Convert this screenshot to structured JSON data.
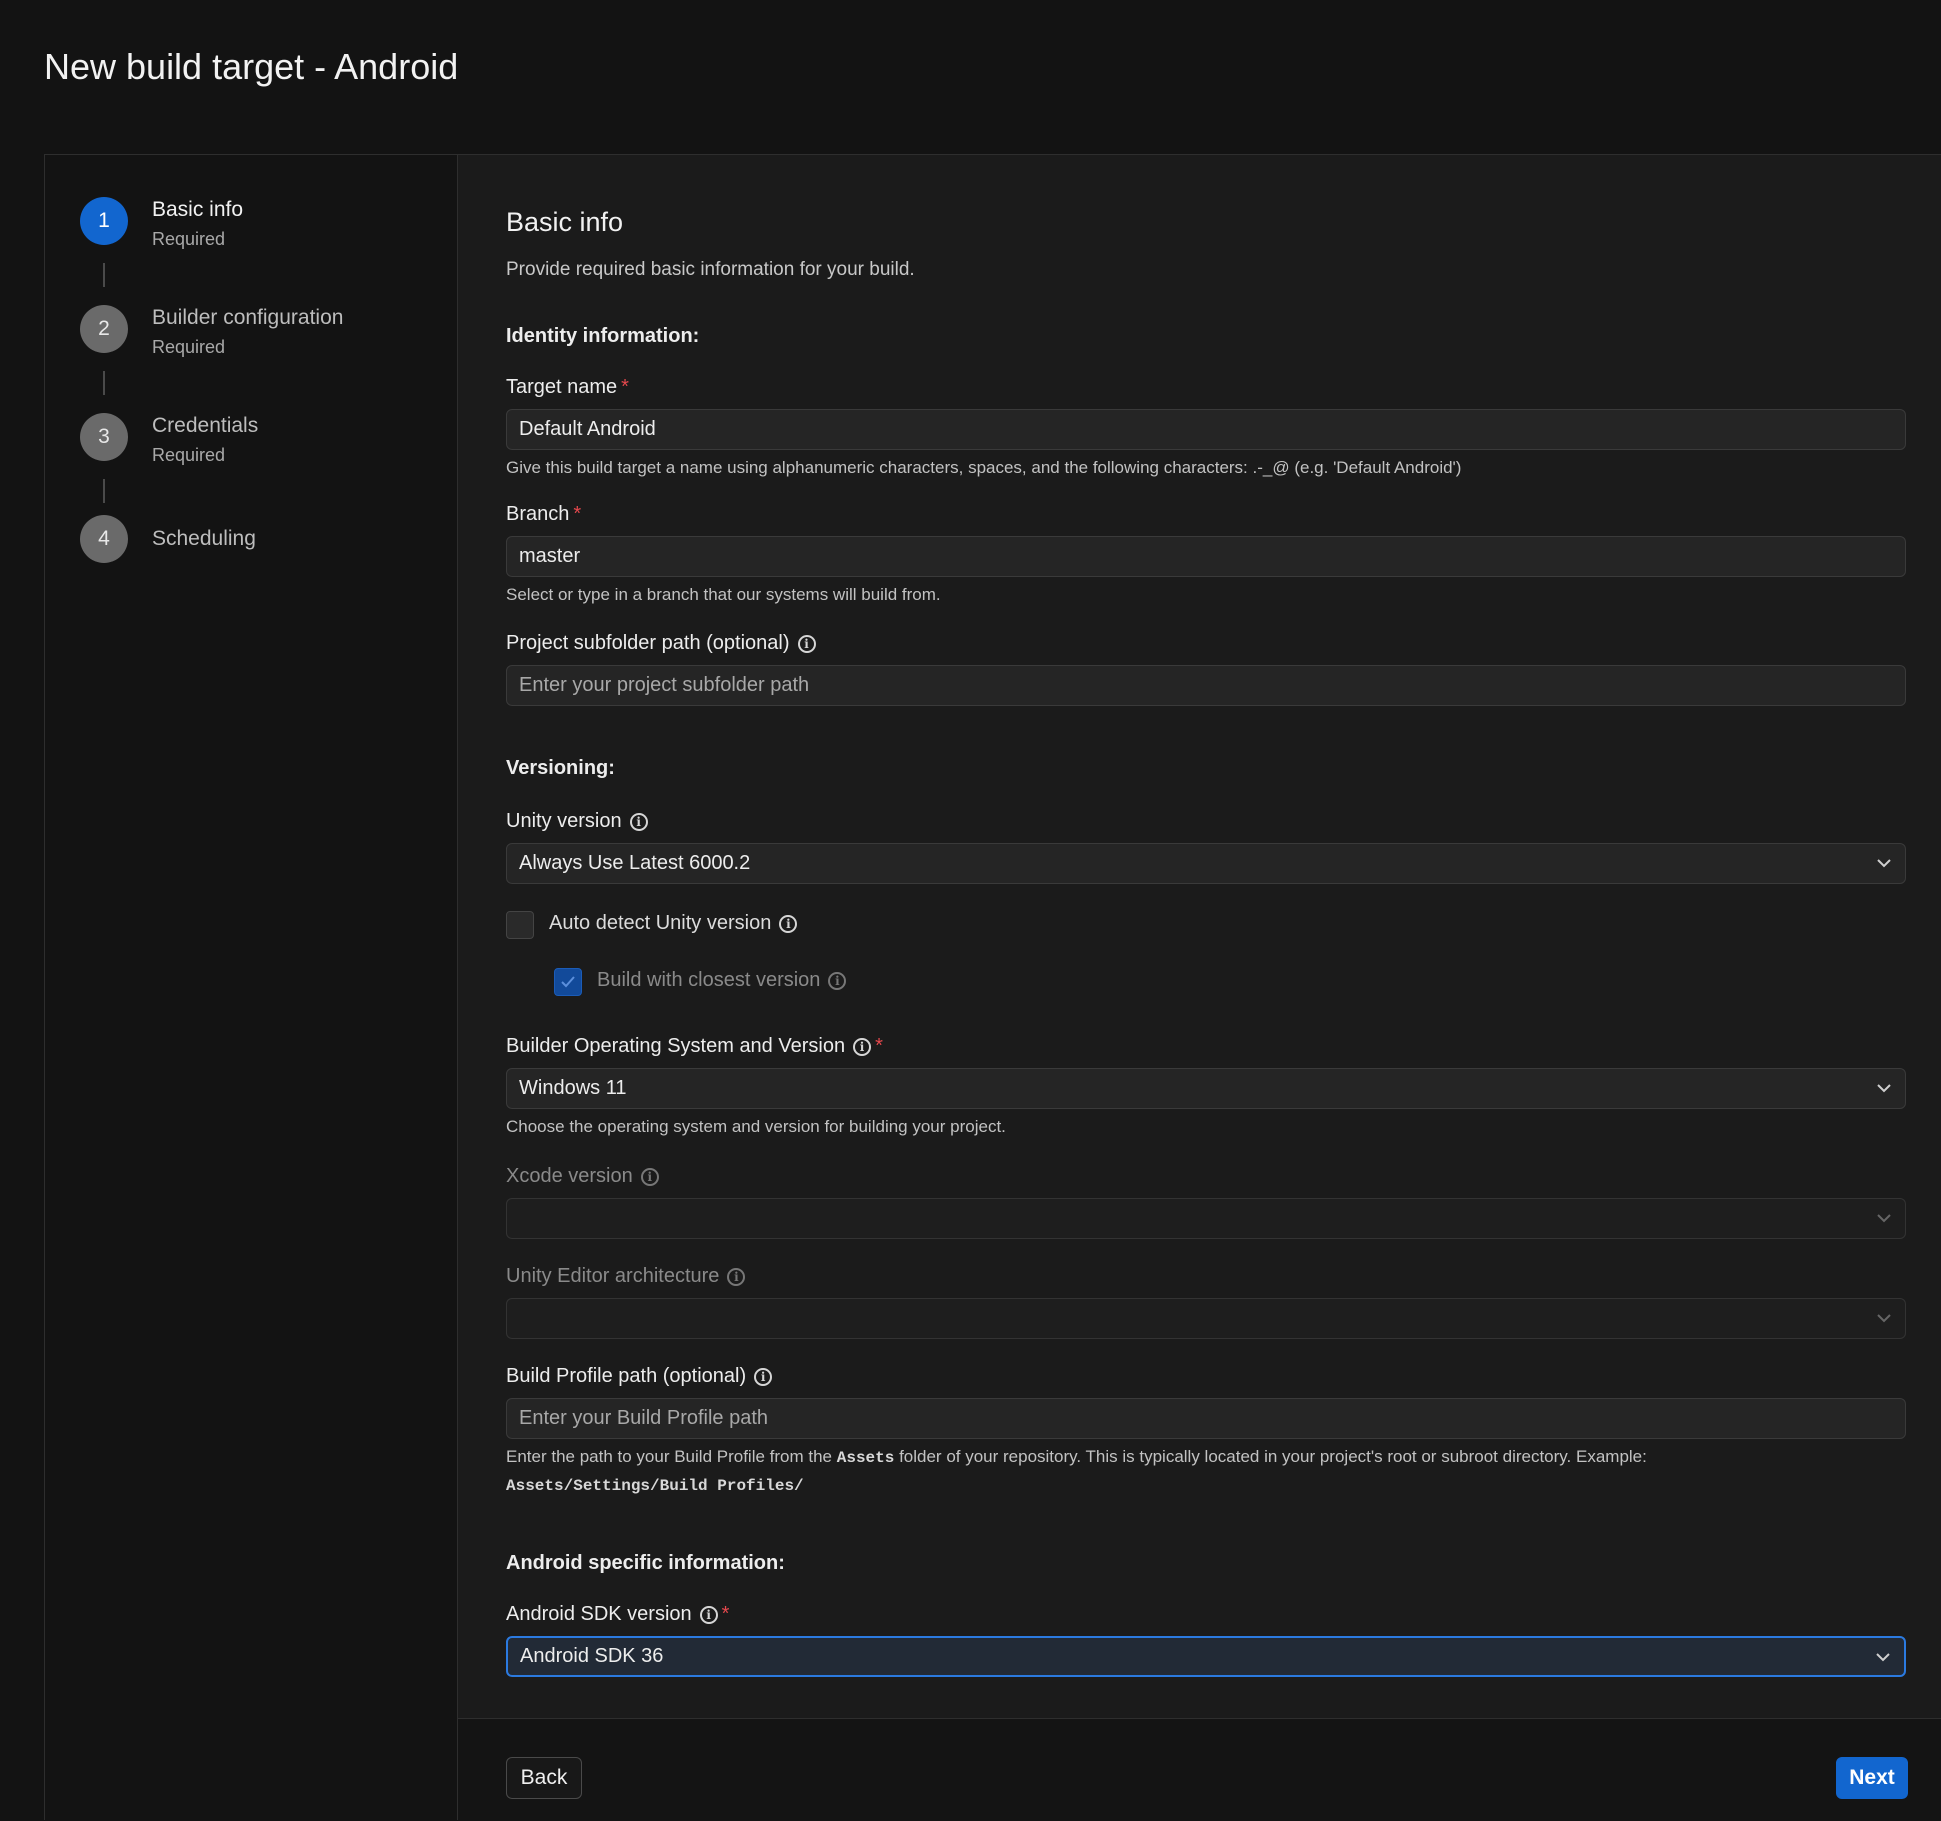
{
  "page": {
    "title": "New build target - Android"
  },
  "steps": [
    {
      "number": "1",
      "title": "Basic info",
      "subtitle": "Required",
      "active": true
    },
    {
      "number": "2",
      "title": "Builder configuration",
      "subtitle": "Required",
      "active": false
    },
    {
      "number": "3",
      "title": "Credentials",
      "subtitle": "Required",
      "active": false
    },
    {
      "number": "4",
      "title": "Scheduling",
      "subtitle": "",
      "active": false
    }
  ],
  "form": {
    "title": "Basic info",
    "description": "Provide required basic information for your build.",
    "identity": {
      "heading": "Identity information:",
      "target_name": {
        "label": "Target name",
        "required": "*",
        "value": "Default Android",
        "help": "Give this build target a name using alphanumeric characters, spaces, and the following characters: .-_@ (e.g. 'Default Android')"
      },
      "branch": {
        "label": "Branch",
        "required": "*",
        "value": "master",
        "help": "Select or type in a branch that our systems will build from."
      },
      "subfolder": {
        "label": "Project subfolder path (optional)",
        "placeholder": "Enter your project subfolder path"
      }
    },
    "versioning": {
      "heading": "Versioning:",
      "unity_version": {
        "label": "Unity version",
        "value": "Always Use Latest 6000.2"
      },
      "auto_detect": {
        "label": "Auto detect Unity version",
        "checked": false
      },
      "closest_version": {
        "label": "Build with closest version",
        "checked": true,
        "disabled": true
      },
      "builder_os": {
        "label": "Builder Operating System and Version",
        "required": "*",
        "value": "Windows 11",
        "help": "Choose the operating system and version for building your project."
      },
      "xcode": {
        "label": "Xcode version",
        "value": "",
        "disabled": true
      },
      "editor_arch": {
        "label": "Unity Editor architecture",
        "value": "",
        "disabled": true
      },
      "build_profile": {
        "label": "Build Profile path (optional)",
        "placeholder": "Enter your Build Profile path",
        "help_part1": "Enter the path to your Build Profile from the ",
        "help_code1": "Assets",
        "help_part2": " folder of your repository. This is typically located in your project's root or subroot directory. Example:",
        "help_code2": "Assets/Settings/Build Profiles/"
      }
    },
    "android": {
      "heading": "Android specific information:",
      "sdk": {
        "label": "Android SDK version",
        "required": "*",
        "value": "Android SDK 36"
      }
    }
  },
  "footer": {
    "back_label": "Back",
    "next_label": "Next"
  },
  "colors": {
    "accent": "#1266cf",
    "required": "#e5484d",
    "background": "#131313",
    "panel": "#1b1b1b"
  }
}
